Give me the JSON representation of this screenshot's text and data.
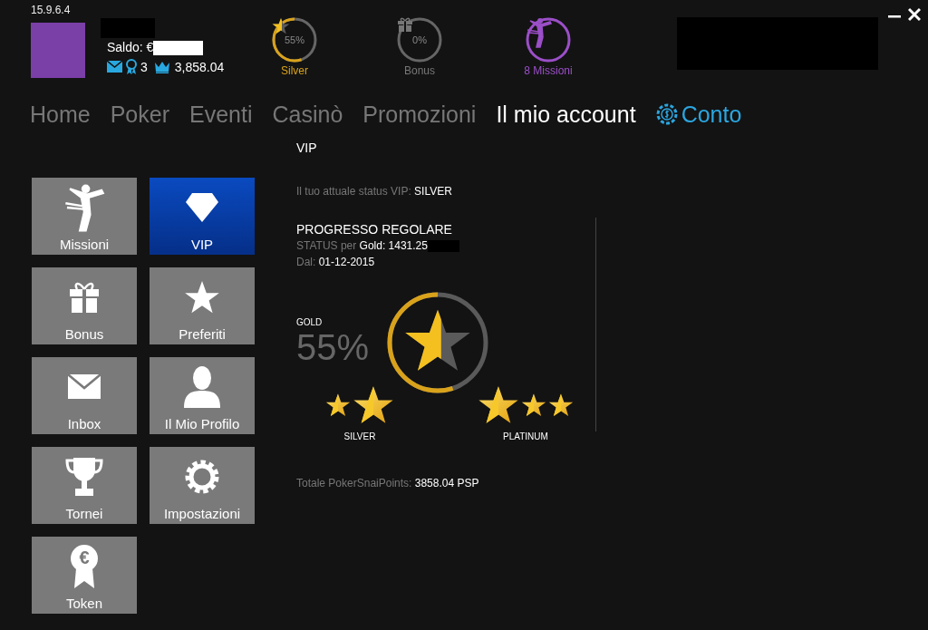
{
  "version": "15.9.6.4",
  "account": {
    "balance_label": "Saldo: €",
    "badges_count": "3",
    "points": "3,858.04"
  },
  "status_circles": [
    {
      "kind": "vip",
      "value": "55%",
      "label": "Silver",
      "level": 0.55
    },
    {
      "kind": "bonus",
      "value": "0%",
      "label": "Bonus",
      "level": 0
    },
    {
      "kind": "missions",
      "label": "8 Missioni"
    }
  ],
  "nav": [
    {
      "label": "Home",
      "kind": "tab",
      "selected": false
    },
    {
      "label": "Poker",
      "kind": "tab",
      "selected": false
    },
    {
      "label": "Eventi",
      "kind": "tab",
      "selected": false
    },
    {
      "label": "Casinò",
      "kind": "tab",
      "selected": false
    },
    {
      "label": "Promozioni",
      "kind": "tab",
      "selected": false
    },
    {
      "label": "Il mio account",
      "kind": "tab",
      "selected": true
    },
    {
      "label": "Conto",
      "kind": "cashier"
    }
  ],
  "tiles": [
    {
      "label": "Missioni",
      "kind": "missions",
      "selected": false
    },
    {
      "label": "VIP",
      "kind": "diamond",
      "selected": true
    },
    {
      "label": "Bonus",
      "kind": "gift",
      "selected": false
    },
    {
      "label": "Preferiti",
      "kind": "star",
      "selected": false
    },
    {
      "label": "Inbox",
      "kind": "mail",
      "selected": false
    },
    {
      "label": "Il Mio Profilo",
      "kind": "profile",
      "selected": false
    },
    {
      "label": "Tornei",
      "kind": "trophy",
      "selected": false
    },
    {
      "label": "Impostazioni",
      "kind": "gear",
      "selected": false
    },
    {
      "label": "Token",
      "kind": "medal",
      "badge_text": "€",
      "selected": false
    }
  ],
  "vip": {
    "title": "VIP",
    "current_status": "Il tuo attuale status VIP: **SILVER**",
    "progress_title": "PROGRESSO REGOLARE",
    "target": "STATUS per **Gold: 1431.25**",
    "since": "Dal: **01-12-2015**",
    "next_level": "GOLD",
    "percent": "55%",
    "level": 0.55,
    "tiers": [
      {
        "label": "SILVER",
        "kind": "previous"
      },
      {
        "label": "PLATINUM",
        "kind": "next"
      }
    ],
    "total": "Totale PokerSnaiPoints: **3858.04 PSP**"
  }
}
